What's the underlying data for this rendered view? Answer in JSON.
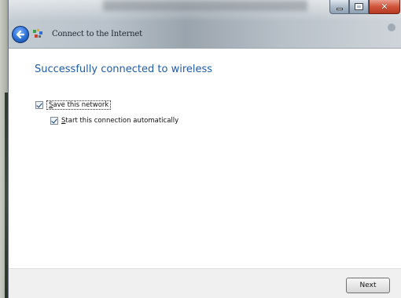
{
  "window": {
    "title": "Connect to the Internet"
  },
  "page": {
    "heading": "Successfully connected to wireless"
  },
  "options": {
    "save_network": {
      "label_accel": "S",
      "label_rest": "ave this network",
      "checked": true
    },
    "auto_connect": {
      "label_accel": "S",
      "label_rest": "tart this connection automatically",
      "checked": true
    }
  },
  "footer": {
    "next_label": "Next"
  },
  "colors": {
    "heading": "#1f5cab",
    "close_button": "#d0543b"
  }
}
